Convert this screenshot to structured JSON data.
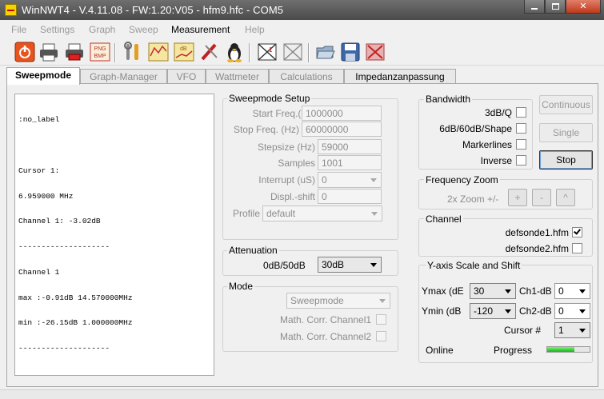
{
  "window": {
    "title": "WinNWT4 - V.4.11.08 - FW:1.20:V05 - hfm9.hfc - COM5"
  },
  "menu": [
    {
      "label": "File",
      "enabled": false
    },
    {
      "label": "Settings",
      "enabled": false
    },
    {
      "label": "Graph",
      "enabled": false
    },
    {
      "label": "Sweep",
      "enabled": false
    },
    {
      "label": "Measurement",
      "enabled": true
    },
    {
      "label": "Help",
      "enabled": false
    }
  ],
  "tabs": [
    "Sweepmode",
    "Graph-Manager",
    "VFO",
    "Wattmeter",
    "Calculations",
    "Impedanzanpassung"
  ],
  "output": {
    "lines": [
      ":no_label",
      "",
      "Cursor 1:",
      "6.959000 MHz",
      "Channel 1: -3.02dB",
      "--------------------",
      "Channel 1",
      "max :-0.91dB 14.570000MHz",
      "min :-26.15dB 1.000000MHz",
      "--------------------"
    ]
  },
  "sweep_setup": {
    "title": "Sweepmode Setup",
    "start_label": "Start Freq.(Hz)",
    "start_value": "1000000",
    "stop_label": "Stop Freq. (Hz)",
    "stop_value": "60000000",
    "step_label": "Stepsize (Hz)",
    "step_value": "59000",
    "samples_label": "Samples",
    "samples_value": "1001",
    "interrupt_label": "Interrupt (uS)",
    "interrupt_value": "0",
    "displ_label": "Displ.-shift",
    "displ_value": "0",
    "profile_label": "Profile",
    "profile_value": "default"
  },
  "attenuation": {
    "title": "Attenuation",
    "label": "0dB/50dB",
    "value": "30dB"
  },
  "mode": {
    "title": "Mode",
    "value": "Sweepmode",
    "corr1_label": "Math. Corr. Channel1",
    "corr1_checked": false,
    "corr2_label": "Math. Corr. Channel2",
    "corr2_checked": false
  },
  "bandwidth": {
    "title": "Bandwidth",
    "options": [
      {
        "label": "3dB/Q",
        "checked": false
      },
      {
        "label": "6dB/60dB/Shape",
        "checked": false
      },
      {
        "label": "Markerlines",
        "checked": false
      },
      {
        "label": "Inverse",
        "checked": false
      }
    ]
  },
  "actions": {
    "continuous": "Continuous",
    "single": "Single",
    "stop": "Stop"
  },
  "freq_zoom": {
    "title": "Frequency Zoom",
    "label": "2x Zoom +/-",
    "plus": "+",
    "minus": "-",
    "reset": "^"
  },
  "channel": {
    "title": "Channel",
    "items": [
      {
        "label": "defsonde1.hfm",
        "checked": true
      },
      {
        "label": "defsonde2.hfm",
        "checked": false
      }
    ]
  },
  "yaxis": {
    "title": "Y-axis Scale and Shift",
    "ymax_label": "Ymax (dE",
    "ymax_value": "30",
    "ymin_label": "Ymin (dB",
    "ymin_value": "-120",
    "ch1_label": "Ch1-dB",
    "ch1_value": "0",
    "ch2_label": "Ch2-dB",
    "ch2_value": "0",
    "cursor_label": "Cursor #",
    "cursor_value": "1",
    "online_label": "Online",
    "progress_label": "Progress",
    "progress_fraction": 0.65
  },
  "icons": [
    "power-icon",
    "printer-icon",
    "printer-color-icon",
    "png-bmp-export-icon",
    "tools-icon",
    "chart-icon",
    "db-chart-icon",
    "probe-icon",
    "linux-penguin-icon",
    "calibrate-x1-icon",
    "calibrate-probe-icon",
    "open-folder-icon",
    "save-disk-icon",
    "delete-icon"
  ],
  "colors": {
    "titlebar": "#5a5a5a",
    "close": "#c8452a",
    "progress": "#22c022"
  }
}
